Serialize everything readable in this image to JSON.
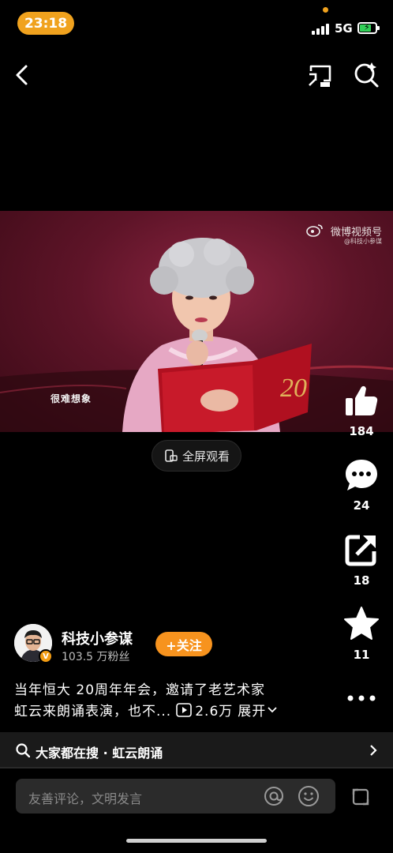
{
  "status": {
    "time": "23:18",
    "network": "5G",
    "colors": {
      "accent": "#f0a21e",
      "battery": "#32d158"
    }
  },
  "nav": {
    "back_icon": "chevron-left-icon",
    "cast_icon": "cast-icon",
    "search_icon": "search-icon"
  },
  "video": {
    "watermark_brand": "微博视频号",
    "watermark_account": "@科技小参谋",
    "subtitle": "很难想象",
    "fullscreen_label": "全屏观看"
  },
  "actions": {
    "likes": "184",
    "comments": "24",
    "shares": "18",
    "favorites": "11"
  },
  "author": {
    "name": "科技小参谋",
    "fans": "103.5 万粉丝",
    "follow_label": "+关注",
    "badge": "V"
  },
  "description": {
    "line1": "当年恒大 20周年年会，邀请了老艺术家",
    "line2": "虹云来朗诵表演，也不...",
    "plays": "2.6万",
    "expand_label": "展开"
  },
  "hot_search": {
    "text": "大家都在搜 · 虹云朗诵"
  },
  "comment": {
    "placeholder": "友善评论，文明发言"
  }
}
